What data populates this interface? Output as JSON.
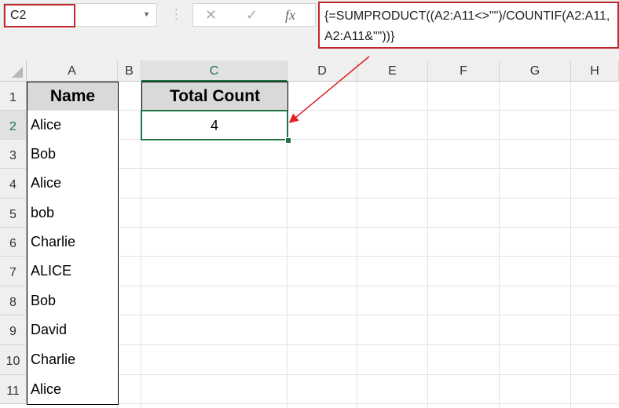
{
  "name_box": "C2",
  "formula": "{=SUMPRODUCT((A2:A11<>\"\")/COUNTIF(A2:A11,A2:A11&\"\"))}",
  "toolbar": {
    "cancel": "✕",
    "enter": "✓",
    "fx": "fx"
  },
  "columns": [
    "A",
    "B",
    "C",
    "D",
    "E",
    "F",
    "G",
    "H"
  ],
  "rows": [
    "1",
    "2",
    "3",
    "4",
    "5",
    "6",
    "7",
    "8",
    "9",
    "10",
    "11"
  ],
  "headers": {
    "name": "Name",
    "total": "Total Count"
  },
  "names": [
    "Alice",
    "Bob",
    "Alice",
    "bob",
    "Charlie",
    "ALICE",
    "Bob",
    "David",
    "Charlie",
    "Alice"
  ],
  "total_count": "4",
  "colors": {
    "highlight": "#c0282d",
    "selection": "#217346",
    "header_fill": "#d9d9d9"
  }
}
